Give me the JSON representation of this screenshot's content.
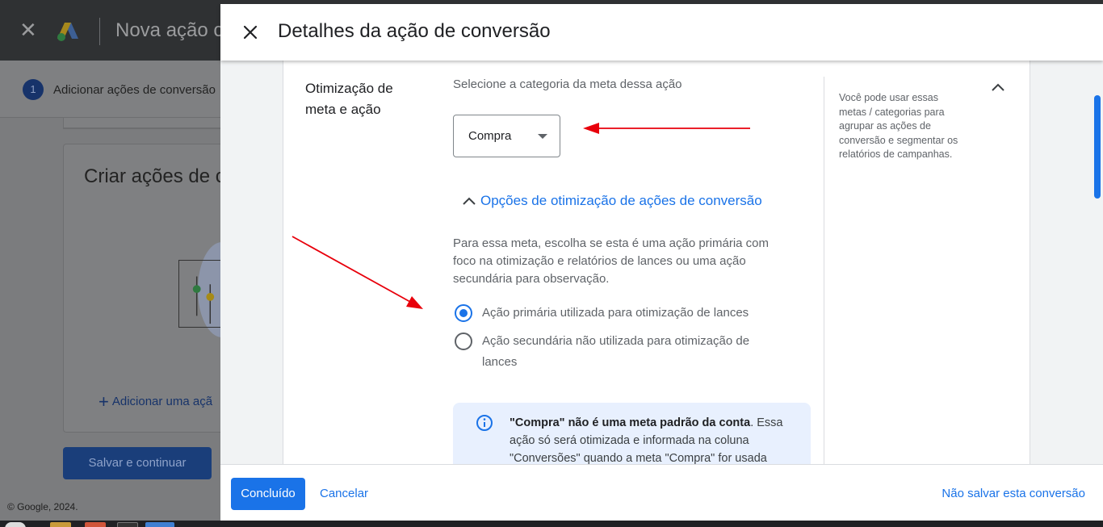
{
  "background": {
    "title": "Nova ação c",
    "step": {
      "number": "1",
      "label": "Adicionar ações de conversão"
    },
    "card_title": "Criar ações de c",
    "add_link": "Adicionar uma açã",
    "save_button": "Salvar e continuar",
    "footer": "© Google, 2024."
  },
  "panel": {
    "title": "Detalhes da ação de conversão",
    "section_label": "Otimização de meta e ação",
    "category_hint": "Selecione a categoria da meta dessa ação",
    "category_value": "Compra",
    "options_toggle": "Opções de otimização de ações de conversão",
    "options_description": "Para essa meta, escolha se esta é uma ação primária com foco na otimização e relatórios de lances ou uma ação secundária para observação.",
    "radio_options": [
      {
        "label": "Ação primária utilizada para otimização de lances",
        "checked": true
      },
      {
        "label": "Ação secundária não utilizada para otimização de lances",
        "checked": false
      }
    ],
    "info_bold": "\"Compra\" não é uma meta padrão da conta",
    "info_text": ". Essa ação só será otimizada e informada na coluna \"Conversões\" quando a meta \"Compra\" for usada",
    "help_text": "Você pode usar essas metas / categorias para agrupar as ações de conversão e segmentar os relatórios de campanhas.",
    "done_button": "Concluído",
    "cancel_button": "Cancelar",
    "nosave_button": "Não salvar esta conversão"
  },
  "colors": {
    "accent": "#1a73e8",
    "annotation_arrow": "#e8000b"
  }
}
